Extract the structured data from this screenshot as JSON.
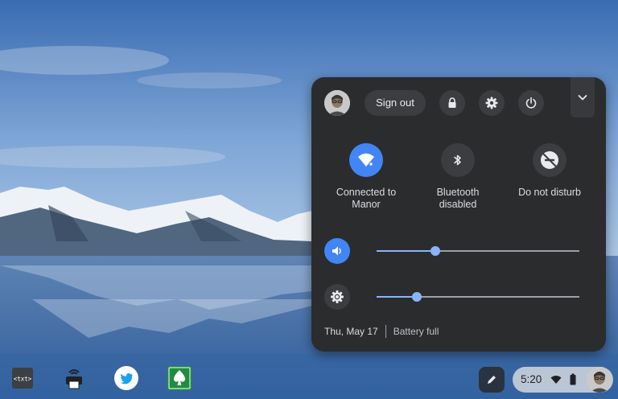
{
  "quick_settings": {
    "sign_out_label": "Sign out",
    "buttons": {
      "lock": "lock-icon",
      "settings": "gear-icon",
      "power": "power-icon",
      "collapse": "chevron-down-icon"
    },
    "toggles": [
      {
        "label": "Connected to Manor",
        "icon": "wifi-icon",
        "active": true
      },
      {
        "label": "Bluetooth disabled",
        "icon": "bluetooth-icon",
        "active": false
      },
      {
        "label": "Do not disturb",
        "icon": "do-not-disturb-icon",
        "active": false
      }
    ],
    "volume": {
      "icon": "speaker-icon",
      "level": 0.29
    },
    "brightness": {
      "icon": "brightness-icon",
      "level": 0.2
    },
    "date": "Thu, May 17",
    "battery_status": "Battery full"
  },
  "shelf": {
    "apps": [
      {
        "name": "text-editor",
        "icon": "txt-icon",
        "text": "<txt>"
      },
      {
        "name": "printer",
        "icon": "printer-icon"
      },
      {
        "name": "twitter",
        "icon": "twitter-bird-icon"
      },
      {
        "name": "solitaire",
        "icon": "spade-icon"
      }
    ],
    "clock": "5:20",
    "status_icons": [
      "wifi-icon",
      "battery-icon"
    ]
  },
  "colors": {
    "accent": "#8ab4f8",
    "active_toggle": "#4285f4",
    "panel_bg": "#2b2c2e"
  }
}
